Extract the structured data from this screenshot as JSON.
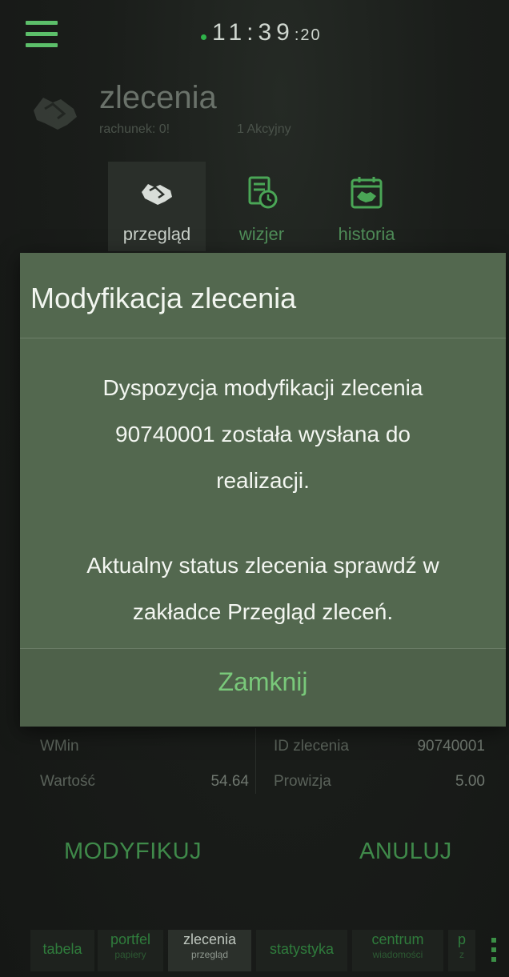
{
  "topbar": {
    "time_main": "11:39",
    "time_seconds": ":20"
  },
  "header": {
    "title": "zlecenia",
    "account_label": "rachunek: 0!",
    "account_type": "1 Akcyjny"
  },
  "tabs": [
    {
      "label": "przegląd",
      "icon": "handshake-icon"
    },
    {
      "label": "wizjer",
      "icon": "document-clock-icon"
    },
    {
      "label": "historia",
      "icon": "calendar-handshake-icon"
    }
  ],
  "modal": {
    "title": "Modyfikacja zlecenia",
    "line1": "Dyspozycja modyfikacji zlecenia",
    "line2": "90740001 została wysłana do",
    "line3": "realizacji.",
    "line4": "Aktualny status zlecenia sprawdź w",
    "line5": "zakładce Przegląd zleceń.",
    "close_label": "Zamknij"
  },
  "details": {
    "wmin_label": "WMin",
    "wmin_value": "",
    "order_id_label": "ID zlecenia",
    "order_id_value": "90740001",
    "value_label": "Wartość",
    "value_value": "54.64",
    "commission_label": "Prowizja",
    "commission_value": "5.00"
  },
  "actions": {
    "modify_label": "MODYFIKUJ",
    "cancel_label": "ANULUJ"
  },
  "bottom_tabs": [
    {
      "main": "tabela",
      "sub": ""
    },
    {
      "main": "portfel",
      "sub": "papiery"
    },
    {
      "main": "zlecenia",
      "sub": "przegląd"
    },
    {
      "main": "statystyka",
      "sub": ""
    },
    {
      "main": "centrum",
      "sub": "wiadomości"
    },
    {
      "main": "p",
      "sub": "z"
    }
  ],
  "colors": {
    "accent": "#5cbf6a",
    "modal_bg": "#53684f",
    "close_text": "#79c87a",
    "action_text": "#3f8a4a"
  }
}
